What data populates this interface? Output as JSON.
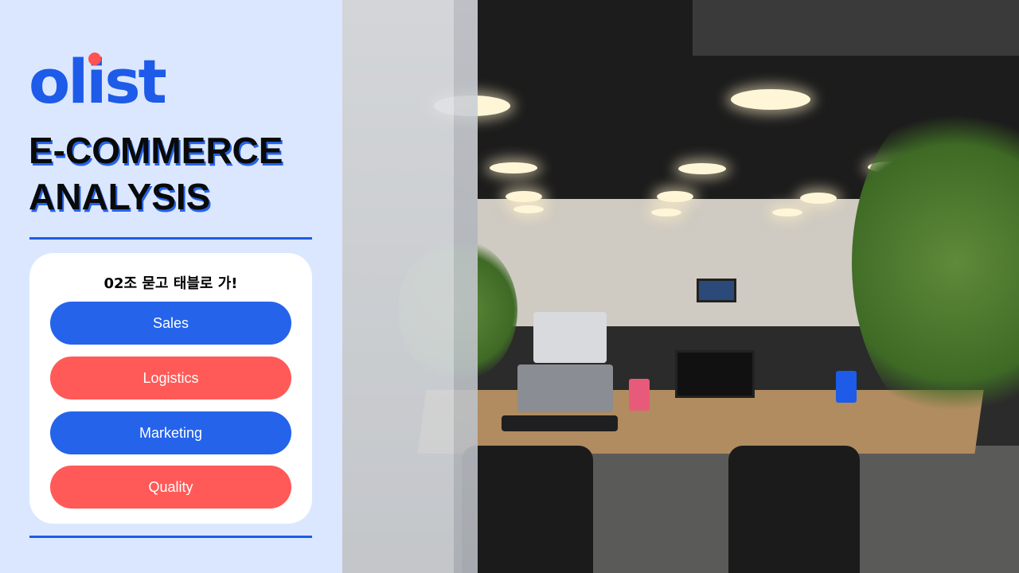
{
  "brand": {
    "logo_text": "olist",
    "logo_color": "#1d5be8",
    "logo_dot_color": "#ff5252"
  },
  "title": {
    "line1": "E-COMMERCE",
    "line2": "ANALYSIS",
    "color": "#0a0a0a",
    "shadow_color": "#2563eb"
  },
  "card": {
    "heading": "02조 묻고 태블로 가!",
    "items": [
      {
        "label": "Sales",
        "color": "#2563eb"
      },
      {
        "label": "Logistics",
        "color": "#ff5a57"
      },
      {
        "label": "Marketing",
        "color": "#2563eb"
      },
      {
        "label": "Quality",
        "color": "#ff5a57"
      }
    ]
  },
  "colors": {
    "panel_bg": "#dbe7ff",
    "divider": "#1d5be8",
    "card_bg": "#ffffff"
  }
}
